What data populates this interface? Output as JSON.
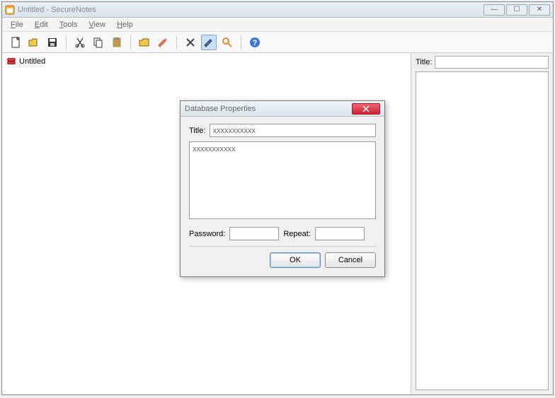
{
  "window": {
    "title": "Untitled - SecureNotes"
  },
  "menubar": [
    "File",
    "Edit",
    "Tools",
    "View",
    "Help"
  ],
  "toolbar_icons": [
    "new",
    "open",
    "save",
    "cut",
    "copy",
    "paste",
    "folder",
    "note",
    "delete",
    "edit",
    "search",
    "help"
  ],
  "tree": {
    "root_label": "Untitled"
  },
  "right_panel": {
    "title_label": "Title:",
    "title_value": ""
  },
  "dialog": {
    "title": "Database Properties",
    "title_label": "Title:",
    "title_value": "xxxxxxxxxxx",
    "description_value": "xxxxxxxxxxx",
    "password_label": "Password:",
    "password_value": "",
    "repeat_label": "Repeat:",
    "repeat_value": "",
    "ok_label": "OK",
    "cancel_label": "Cancel"
  }
}
